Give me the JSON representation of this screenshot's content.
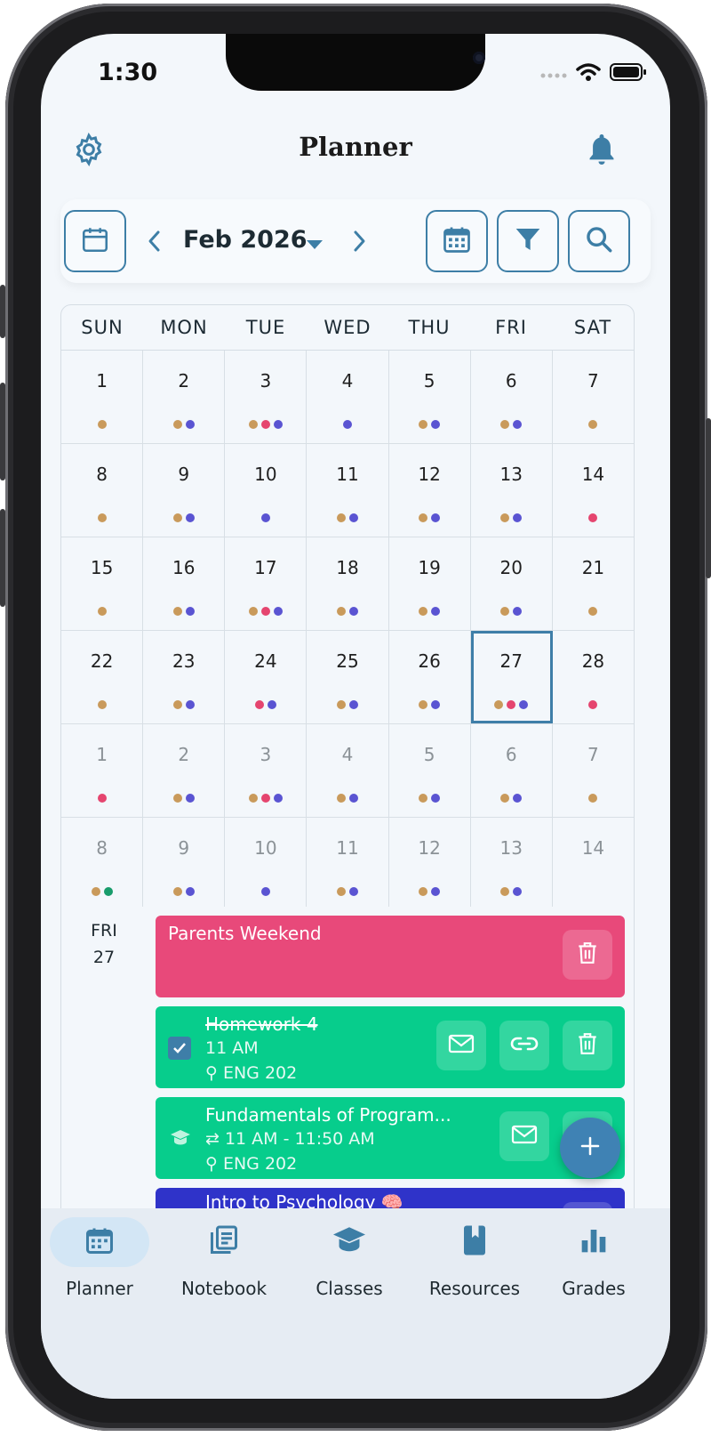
{
  "status_bar": {
    "time": "1:30"
  },
  "header": {
    "title": "Planner",
    "settings_icon": "gear-icon",
    "notifications_icon": "bell-icon"
  },
  "toolbar": {
    "month_label": "Feb 2026",
    "today_icon": "calendar-icon",
    "prev_icon": "chevron-left-icon",
    "next_icon": "chevron-right-icon",
    "dropdown_icon": "caret-down-icon",
    "view_icon": "calendar-grid-icon",
    "filter_icon": "filter-icon",
    "search_icon": "search-icon"
  },
  "colors": {
    "accent": "#3e7ea8",
    "tan": "#c99a5b",
    "purple": "#5a54d2",
    "pink": "#e5456f",
    "green": "#189c6b",
    "event_pink": "#e8497a",
    "event_green": "#07cd8c",
    "event_blue": "#2f33c9"
  },
  "calendar": {
    "weekdays": [
      "SUN",
      "MON",
      "TUE",
      "WED",
      "THU",
      "FRI",
      "SAT"
    ],
    "weeks": [
      [
        {
          "d": "1",
          "dots": [
            "tan"
          ]
        },
        {
          "d": "2",
          "dots": [
            "tan",
            "purple"
          ]
        },
        {
          "d": "3",
          "dots": [
            "tan",
            "pink",
            "purple"
          ]
        },
        {
          "d": "4",
          "dots": [
            "purple"
          ]
        },
        {
          "d": "5",
          "dots": [
            "tan",
            "purple"
          ]
        },
        {
          "d": "6",
          "dots": [
            "tan",
            "purple"
          ]
        },
        {
          "d": "7",
          "dots": [
            "tan"
          ]
        }
      ],
      [
        {
          "d": "8",
          "dots": [
            "tan"
          ]
        },
        {
          "d": "9",
          "dots": [
            "tan",
            "purple"
          ]
        },
        {
          "d": "10",
          "dots": [
            "purple"
          ]
        },
        {
          "d": "11",
          "dots": [
            "tan",
            "purple"
          ]
        },
        {
          "d": "12",
          "dots": [
            "tan",
            "purple"
          ]
        },
        {
          "d": "13",
          "dots": [
            "tan",
            "purple"
          ]
        },
        {
          "d": "14",
          "dots": [
            "pink"
          ]
        }
      ],
      [
        {
          "d": "15",
          "dots": [
            "tan"
          ]
        },
        {
          "d": "16",
          "dots": [
            "tan",
            "purple"
          ]
        },
        {
          "d": "17",
          "dots": [
            "tan",
            "pink",
            "purple"
          ]
        },
        {
          "d": "18",
          "dots": [
            "tan",
            "purple"
          ]
        },
        {
          "d": "19",
          "dots": [
            "tan",
            "purple"
          ]
        },
        {
          "d": "20",
          "dots": [
            "tan",
            "purple"
          ]
        },
        {
          "d": "21",
          "dots": [
            "tan"
          ]
        }
      ],
      [
        {
          "d": "22",
          "dots": [
            "tan"
          ]
        },
        {
          "d": "23",
          "dots": [
            "tan",
            "purple"
          ]
        },
        {
          "d": "24",
          "dots": [
            "pink",
            "purple"
          ]
        },
        {
          "d": "25",
          "dots": [
            "tan",
            "purple"
          ]
        },
        {
          "d": "26",
          "dots": [
            "tan",
            "purple"
          ]
        },
        {
          "d": "27",
          "dots": [
            "tan",
            "pink",
            "purple"
          ],
          "selected": true
        },
        {
          "d": "28",
          "dots": [
            "pink"
          ]
        }
      ],
      [
        {
          "d": "1",
          "dots": [
            "pink"
          ],
          "other": true
        },
        {
          "d": "2",
          "dots": [
            "tan",
            "purple"
          ],
          "other": true
        },
        {
          "d": "3",
          "dots": [
            "tan",
            "pink",
            "purple"
          ],
          "other": true
        },
        {
          "d": "4",
          "dots": [
            "tan",
            "purple"
          ],
          "other": true
        },
        {
          "d": "5",
          "dots": [
            "tan",
            "purple"
          ],
          "other": true
        },
        {
          "d": "6",
          "dots": [
            "tan",
            "purple"
          ],
          "other": true
        },
        {
          "d": "7",
          "dots": [
            "tan"
          ],
          "other": true
        }
      ],
      [
        {
          "d": "8",
          "dots": [
            "tan",
            "green"
          ],
          "other": true
        },
        {
          "d": "9",
          "dots": [
            "tan",
            "purple"
          ],
          "other": true
        },
        {
          "d": "10",
          "dots": [
            "purple"
          ],
          "other": true
        },
        {
          "d": "11",
          "dots": [
            "tan",
            "purple"
          ],
          "other": true
        },
        {
          "d": "12",
          "dots": [
            "tan",
            "purple"
          ],
          "other": true
        },
        {
          "d": "13",
          "dots": [
            "tan",
            "purple"
          ],
          "other": true
        },
        {
          "d": "14",
          "dots": [],
          "other": true
        }
      ]
    ]
  },
  "agenda": {
    "day_name": "FRI",
    "day_num": "27",
    "events": [
      {
        "title": "Parents Weekend",
        "actions": [
          "trash-icon"
        ]
      },
      {
        "title": "Homework 4",
        "time": "11 AM",
        "location": "ENG 202",
        "completed": true,
        "actions": [
          "mail-icon",
          "link-icon",
          "trash-icon"
        ]
      },
      {
        "title": "Fundamentals of Program...",
        "time": "11 AM - 11:50 AM",
        "location": "ENG 202",
        "recurring": true,
        "actions": [
          "mail-icon"
        ]
      },
      {
        "title": "Intro to Psychology 🧠"
      }
    ]
  },
  "fab": {
    "icon": "plus-icon"
  },
  "nav": {
    "items": [
      {
        "label": "Planner",
        "icon": "calendar-icon",
        "active": true
      },
      {
        "label": "Notebook",
        "icon": "notebook-icon"
      },
      {
        "label": "Classes",
        "icon": "graduation-cap-icon"
      },
      {
        "label": "Resources",
        "icon": "book-icon"
      },
      {
        "label": "Grades",
        "icon": "bar-chart-icon"
      }
    ]
  }
}
